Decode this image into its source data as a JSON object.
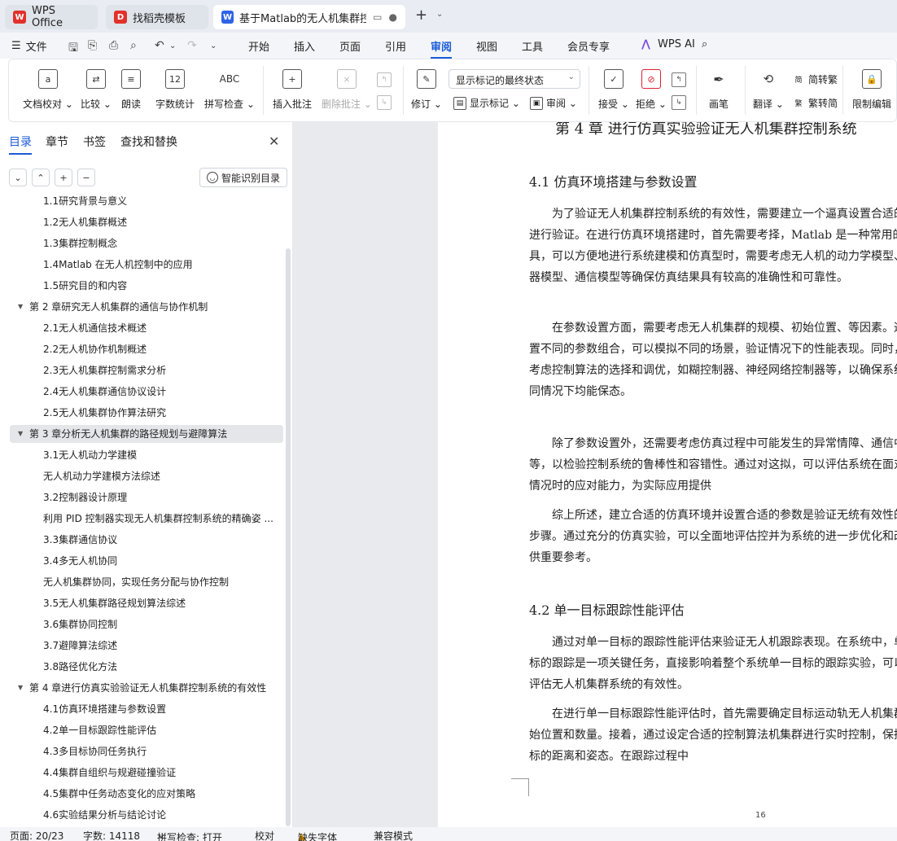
{
  "tabs": [
    {
      "label": "WPS Office",
      "logo": "W",
      "color": "#e0322b"
    },
    {
      "label": "找稻壳模板",
      "logo": "D",
      "color": "#e0322b"
    },
    {
      "label": "基于Matlab的无人机集群控制",
      "logo": "W",
      "color": "#2f63e6"
    }
  ],
  "menubar": {
    "file": "文件",
    "items": [
      "开始",
      "插入",
      "页面",
      "引用",
      "审阅",
      "视图",
      "工具",
      "会员专享"
    ],
    "active": "审阅",
    "wpsai": "WPS AI"
  },
  "ribbon": {
    "doc_proof": "文档校对",
    "compare": "比较",
    "read_aloud": "朗读",
    "word_count": "字数统计",
    "spell_check": "拼写检查",
    "insert_comment": "插入批注",
    "delete_comment": "删除批注",
    "revise": "修订",
    "markup_select": "显示标记的最终状态",
    "show_markup": "显示标记",
    "review": "审阅",
    "accept": "接受",
    "reject": "拒绝",
    "ink": "画笔",
    "translate": "翻译",
    "to_traditional": "简转繁",
    "to_simplified": "繁转简",
    "restrict_edit": "限制编辑",
    "abc": "ABC",
    "num12": "12"
  },
  "panel": {
    "tabs": [
      "目录",
      "章节",
      "书签",
      "查找和替换"
    ],
    "smart_toc": "智能识别目录",
    "toc": [
      {
        "text": "1.1研究背景与意义",
        "level": 2
      },
      {
        "text": "1.2无人机集群概述",
        "level": 2
      },
      {
        "text": "1.3集群控制概念",
        "level": 2
      },
      {
        "text": "1.4Matlab 在无人机控制中的应用",
        "level": 2
      },
      {
        "text": "1.5研究目的和内容",
        "level": 2
      },
      {
        "text": "第 2 章研究无人机集群的通信与协作机制",
        "level": 1
      },
      {
        "text": "2.1无人机通信技术概述",
        "level": 2
      },
      {
        "text": "2.2无人机协作机制概述",
        "level": 2
      },
      {
        "text": "2.3无人机集群控制需求分析",
        "level": 2
      },
      {
        "text": "2.4无人机集群通信协议设计",
        "level": 2
      },
      {
        "text": "2.5无人机集群协作算法研究",
        "level": 2
      },
      {
        "text": "第 3 章分析无人机集群的路径规划与避障算法",
        "level": 1
      },
      {
        "text": "3.1无人机动力学建模",
        "level": 2
      },
      {
        "text": "无人机动力学建模方法综述",
        "level": 2
      },
      {
        "text": "3.2控制器设计原理",
        "level": 2
      },
      {
        "text": "利用 PID 控制器实现无人机集群控制系统的精确姿 ...",
        "level": 2
      },
      {
        "text": "3.3集群通信协议",
        "level": 2
      },
      {
        "text": "3.4多无人机协同",
        "level": 2
      },
      {
        "text": "无人机集群协同，实现任务分配与协作控制",
        "level": 2
      },
      {
        "text": "3.5无人机集群路径规划算法综述",
        "level": 2
      },
      {
        "text": "3.6集群协同控制",
        "level": 2
      },
      {
        "text": "3.7避障算法综述",
        "level": 2
      },
      {
        "text": "3.8路径优化方法",
        "level": 2
      },
      {
        "text": "第 4 章进行仿真实验验证无人机集群控制系统的有效性",
        "level": 1
      },
      {
        "text": "4.1仿真环境搭建与参数设置",
        "level": 2
      },
      {
        "text": "4.2单一目标跟踪性能评估",
        "level": 2
      },
      {
        "text": "4.3多目标协同任务执行",
        "level": 2
      },
      {
        "text": "4.4集群自组织与规避碰撞验证",
        "level": 2
      },
      {
        "text": "4.5集群中任务动态变化的应对策略",
        "level": 2
      },
      {
        "text": "4.6实验结果分析与结论讨论",
        "level": 2
      }
    ]
  },
  "document": {
    "chapter": "第 4 章   进行仿真实验验证无人机集群控制系统",
    "sec1": "4.1  仿真环境搭建与参数设置",
    "p1": "为了验证无人机集群控制系统的有效性，需要建立一个逼真设置合适的参数进行验证。在进行仿真环境搭建时，首先需要考择，Matlab 是一种常用的工具，可以方便地进行系统建模和仿真型时，需要考虑无人机的动力学模型、传感器模型、通信模型等确保仿真结果具有较高的准确性和可靠性。",
    "p2": "在参数设置方面，需要考虑无人机集群的规模、初始位置、等因素。通过设置不同的参数组合，可以模拟不同的场景，验证情况下的性能表现。同时，还需考虑控制算法的选择和调优，如糊控制器、神经网络控制器等，以确保系统在不同情况下均能保态。",
    "p3": "除了参数设置外，还需要考虑仿真过程中可能发生的异常情障、通信中断等，以检验控制系统的鲁棒性和容错性。通过对这拟，可以评估系统在面对意外情况时的应对能力，为实际应用提供",
    "p4": "综上所述，建立合适的仿真环境并设置合适的参数是验证无统有效性的关键步骤。通过充分的仿真实验，可以全面地评估控并为系统的进一步优化和改进提供重要参考。",
    "sec2": "4.2 单一目标跟踪性能评估",
    "p5": "通过对单一目标的跟踪性能评估来验证无人机跟踪表现。在系统中，单一目标的跟踪是一项关键任务，直接影响着整个系统单一目标的跟踪实验，可以全面评估无人机集群系统的有效性。",
    "p6": "在进行单一目标跟踪性能评估时，首先需要确定目标运动轨无人机集群的起始位置和数量。接着，通过设定合适的控制算法机集群进行实时控制，保持与目标的距离和姿态。在跟踪过程中",
    "page_number": "16"
  },
  "status": {
    "page": "页面: 20/23",
    "words": "字数: 14118",
    "spell": "拼写检查: 打开",
    "proof": "校对",
    "missing_font": "缺失字体",
    "compat": "兼容模式"
  }
}
